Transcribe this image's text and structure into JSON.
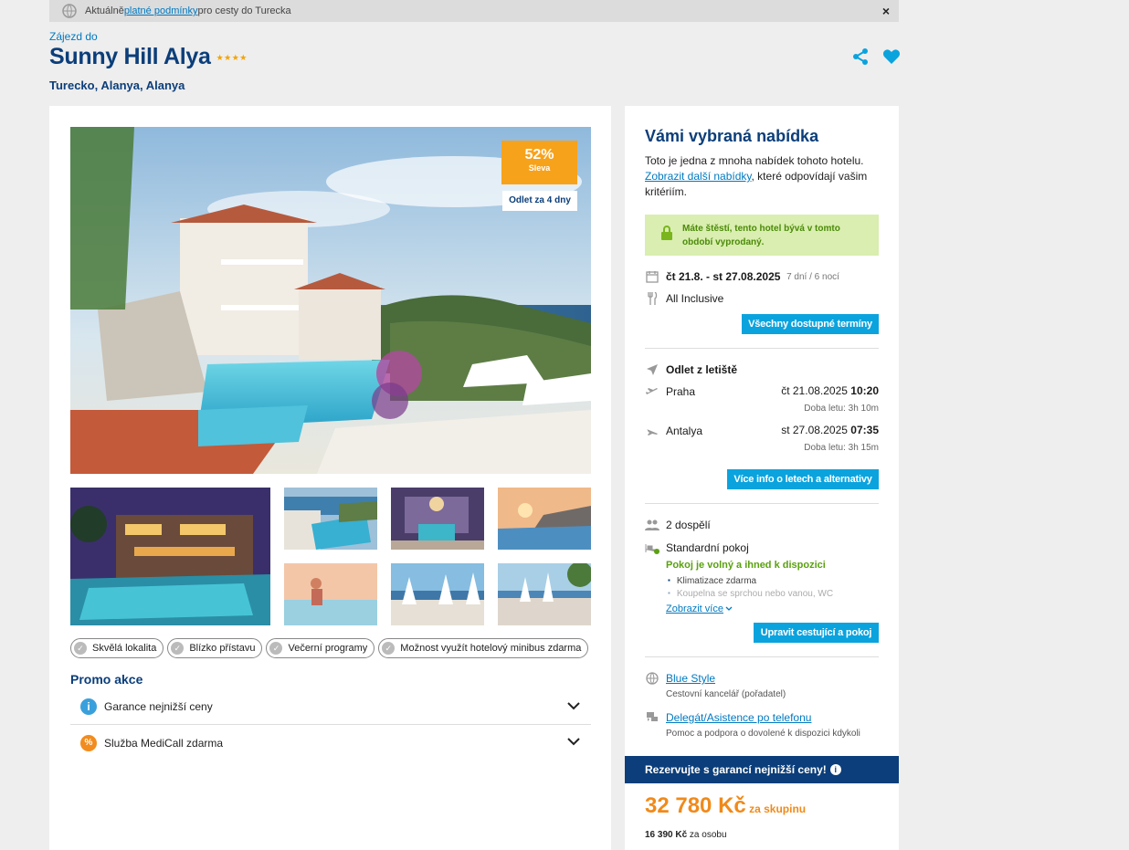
{
  "infobar": {
    "prefix": "Aktuálně ",
    "link": "platné podmínky",
    "suffix": " pro cesty do Turecka",
    "close": "×"
  },
  "hotel": {
    "subtitle": "Zájezd do",
    "name": "Sunny Hill Alya",
    "stars": "★★★★",
    "location": "Turecko, Alanya, Alanya"
  },
  "hero": {
    "discount_pct": "52%",
    "discount_label": "Sleva",
    "departure": "Odlet za 4 dny"
  },
  "tags": [
    "Skvělá lokalita",
    "Blízko přístavu",
    "Večerní programy",
    "Možnost využít hotelový minibus zdarma"
  ],
  "promo": {
    "title": "Promo akce",
    "items": [
      "Garance nejnižší ceny",
      "Služba MediCall zdarma"
    ]
  },
  "offer": {
    "title": "Vámi vybraná nabídka",
    "desc_start": "Toto je jedna z mnoha nabídek tohoto hotelu. ",
    "desc_link": "Zobrazit další nabídky",
    "desc_end": ", které odpovídají vašim kritériím.",
    "lucky": "Máte štěstí, tento hotel bývá v tomto období vyprodaný.",
    "dates": "čt 21.8. - st 27.08.2025",
    "duration": "7 dní / 6 nocí",
    "board": "All Inclusive",
    "btn_terms": "Všechny dostupné termíny",
    "flight_title": "Odlet z letiště",
    "out_city": "Praha",
    "out_date": "čt 21.08.2025",
    "out_time": "10:20",
    "out_dur": "Doba letu: 3h 10m",
    "ret_city": "Antalya",
    "ret_date": "st 27.08.2025",
    "ret_time": "07:35",
    "ret_dur": "Doba letu: 3h 15m",
    "btn_flights": "Více info o letech a alternativy",
    "pax": "2 dospělí",
    "room": "Standardní pokoj",
    "room_status": "Pokoj je volný a ihned k dispozici",
    "amenities": [
      "Klimatizace zdarma",
      "Koupelna se sprchou nebo vanou, WC"
    ],
    "more": "Zobrazit více",
    "btn_edit": "Upravit cestující a pokoj",
    "agency": "Blue Style",
    "agency_role": "Cestovní kancelář (pořadatel)",
    "delegate": "Delegát/Asistence po telefonu",
    "delegate_desc": "Pomoc a podpora o dovolené k dispozici kdykoli",
    "reserve": "Rezervujte s garancí nejnižší ceny!",
    "price": "32 780 Kč",
    "price_unit": " za skupinu",
    "per_person_price": "16 390 Kč",
    "per_person_label": " za osobu"
  },
  "colors": {
    "brand": "#0b3e7a",
    "accent": "#0aa3de",
    "orange": "#f7a21b",
    "green": "#5aa10f"
  }
}
